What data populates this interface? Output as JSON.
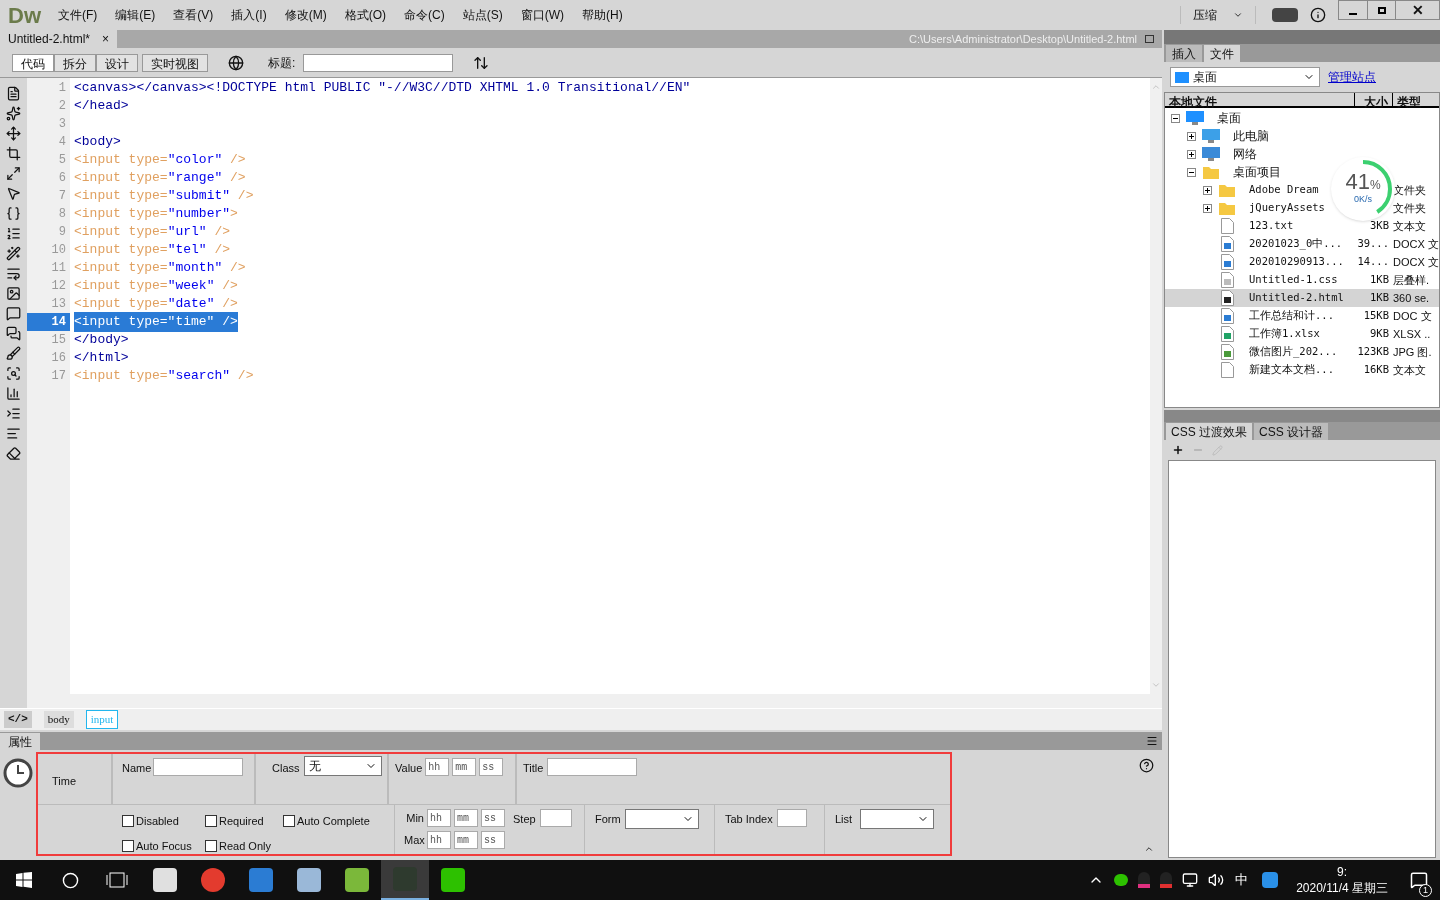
{
  "app": {
    "logo": "Dw",
    "menu": [
      "文件(F)",
      "编辑(E)",
      "查看(V)",
      "插入(I)",
      "修改(M)",
      "格式(O)",
      "命令(C)",
      "站点(S)",
      "窗口(W)",
      "帮助(H)"
    ],
    "compress": "压缩",
    "close": "✕"
  },
  "document": {
    "tab": "Untitled-2.html*",
    "close": "×",
    "path": "C:\\Users\\Administrator\\Desktop\\Untitled-2.html"
  },
  "view_buttons": [
    {
      "label": "代码",
      "selected": true
    },
    {
      "label": "拆分",
      "selected": false
    },
    {
      "label": "设计",
      "selected": false
    },
    {
      "label": "实时视图",
      "selected": false
    }
  ],
  "title_label": "标题:",
  "code": [
    {
      "number": "1",
      "selected": false,
      "segments": [
        {
          "kind": "tag",
          "text": "<canvas></canvas><!DOCTYPE html PUBLIC \"-//W3C//DTD XHTML 1.0 Transitional//EN\""
        }
      ]
    },
    {
      "number": "2",
      "selected": false,
      "segments": [
        {
          "kind": "tag",
          "text": "</head>"
        }
      ]
    },
    {
      "number": "3",
      "selected": false
    },
    {
      "number": "4",
      "selected": false,
      "segments": [
        {
          "kind": "tag",
          "text": "<body>"
        }
      ]
    },
    {
      "number": "5",
      "selected": false,
      "segments": [
        {
          "kind": "faded",
          "text": "<input type="
        },
        {
          "kind": "value",
          "text": "\"color\""
        },
        {
          "kind": "faded",
          "text": " />"
        }
      ]
    },
    {
      "number": "6",
      "selected": false,
      "segments": [
        {
          "kind": "faded",
          "text": "<input type="
        },
        {
          "kind": "value",
          "text": "\"range\""
        },
        {
          "kind": "faded",
          "text": " />"
        }
      ]
    },
    {
      "number": "7",
      "selected": false,
      "segments": [
        {
          "kind": "faded",
          "text": "<input type="
        },
        {
          "kind": "value",
          "text": "\"submit\""
        },
        {
          "kind": "faded",
          "text": " />"
        }
      ]
    },
    {
      "number": "8",
      "selected": false,
      "segments": [
        {
          "kind": "faded",
          "text": "<input type="
        },
        {
          "kind": "value",
          "text": "\"number\""
        },
        {
          "kind": "faded",
          "text": ">"
        }
      ]
    },
    {
      "number": "9",
      "selected": false,
      "segments": [
        {
          "kind": "faded",
          "text": "<input type="
        },
        {
          "kind": "value",
          "text": "\"url\""
        },
        {
          "kind": "faded",
          "text": " />"
        }
      ]
    },
    {
      "number": "10",
      "selected": false,
      "segments": [
        {
          "kind": "faded",
          "text": "<input type="
        },
        {
          "kind": "value",
          "text": "\"tel\""
        },
        {
          "kind": "faded",
          "text": " />"
        }
      ]
    },
    {
      "number": "11",
      "selected": false,
      "segments": [
        {
          "kind": "faded",
          "text": "<input type="
        },
        {
          "kind": "value",
          "text": "\"month\""
        },
        {
          "kind": "faded",
          "text": " />"
        }
      ]
    },
    {
      "number": "12",
      "selected": false,
      "segments": [
        {
          "kind": "faded",
          "text": "<input type="
        },
        {
          "kind": "value",
          "text": "\"week\""
        },
        {
          "kind": "faded",
          "text": " />"
        }
      ]
    },
    {
      "number": "13",
      "selected": false,
      "segments": [
        {
          "kind": "faded",
          "text": "<input type="
        },
        {
          "kind": "value",
          "text": "\"date\""
        },
        {
          "kind": "faded",
          "text": " />"
        }
      ]
    },
    {
      "number": "14",
      "selected": true,
      "segments": [
        {
          "kind": "tag",
          "text": "<input type=\"time\" />"
        }
      ]
    },
    {
      "number": "15",
      "selected": false,
      "segments": [
        {
          "kind": "tag",
          "text": "</body>"
        }
      ]
    },
    {
      "number": "16",
      "selected": false,
      "segments": [
        {
          "kind": "tag",
          "text": "</html>"
        }
      ]
    },
    {
      "number": "17",
      "selected": false,
      "segments": [
        {
          "kind": "faded",
          "text": "<input type="
        },
        {
          "kind": "value",
          "text": "\"search\""
        },
        {
          "kind": "faded",
          "text": " />"
        }
      ]
    }
  ],
  "code_view_toggle": "</>",
  "tag_selector": [
    {
      "label": "body",
      "selected": false
    },
    {
      "label": "input",
      "selected": true
    }
  ],
  "properties": {
    "tab": "属性",
    "element": "Time",
    "name_label": "Name",
    "class_label": "Class",
    "class_value": "无",
    "value_label": "Value",
    "value_fields": [
      {
        "placeholder": "hh"
      },
      {
        "placeholder": "mm"
      },
      {
        "placeholder": "ss"
      }
    ],
    "title_label": "Title",
    "checkboxes": [
      {
        "label": "Disabled",
        "checked": false
      },
      {
        "label": "Required",
        "checked": false
      },
      {
        "label": "Auto Complete",
        "checked": false
      },
      {
        "label": "Auto Focus",
        "checked": false
      },
      {
        "label": "Read Only",
        "checked": false
      }
    ],
    "min_label": "Min",
    "min_fields": [
      {
        "placeholder": "hh"
      },
      {
        "placeholder": "mm"
      },
      {
        "placeholder": "ss"
      }
    ],
    "max_label": "Max",
    "max_fields": [
      {
        "placeholder": "hh"
      },
      {
        "placeholder": "mm"
      },
      {
        "placeholder": "ss"
      }
    ],
    "step_label": "Step",
    "form_label": "Form",
    "tab_index_label": "Tab Index",
    "list_label": "List"
  },
  "files_panel": {
    "tabs": [
      {
        "label": "插入",
        "selected": false
      },
      {
        "label": "文件",
        "selected": true
      }
    ],
    "location": "桌面",
    "manage_link": "管理站点",
    "columns": [
      "本地文件",
      "大小",
      "类型"
    ],
    "tree": [
      {
        "name": "桌面",
        "kind": "desktop",
        "expanded": true,
        "selected": false,
        "children": [
          {
            "name": "此电脑",
            "kind": "computer",
            "expanded": false,
            "selected": false
          },
          {
            "name": "网络",
            "kind": "network",
            "expanded": false,
            "selected": false
          },
          {
            "name": "桌面项目",
            "kind": "folder",
            "expanded": true,
            "selected": false,
            "children": [
              {
                "name": "Adobe Dream",
                "kind": "folder",
                "type": "文件夹",
                "expanded": false,
                "selected": false
              },
              {
                "name": "jQueryAssets",
                "kind": "folder",
                "type": "文件夹",
                "expanded": false,
                "selected": false
              },
              {
                "name": "123.txt",
                "kind": "text",
                "size": "3KB",
                "type": "文本文",
                "selected": false
              },
              {
                "name": "20201023_0中...",
                "kind": "word",
                "size": "39...",
                "type": "DOCX 文",
                "selected": false
              },
              {
                "name": "202010290913...",
                "kind": "word",
                "size": "14...",
                "type": "DOCX 文",
                "selected": false
              },
              {
                "name": "Untitled-1.css",
                "kind": "css",
                "size": "1KB",
                "type": "层叠样.",
                "selected": false
              },
              {
                "name": "Untitled-2.html",
                "kind": "html",
                "size": "1KB",
                "type": "360 se.",
                "selected": true
              },
              {
                "name": "工作总结和计...",
                "kind": "word",
                "size": "15KB",
                "type": "DOC 文",
                "selected": false
              },
              {
                "name": "工作簿1.xlsx",
                "kind": "sheet",
                "size": "9KB",
                "type": "XLSX ..",
                "selected": false
              },
              {
                "name": "微信图片_202...",
                "kind": "image",
                "size": "123KB",
                "type": "JPG 图.",
                "selected": false
              },
              {
                "name": "新建文本文档...",
                "kind": "text",
                "size": "16KB",
                "type": "文本文",
                "selected": false
              }
            ]
          }
        ]
      }
    ]
  },
  "speed_meter": {
    "percent": "41",
    "unit": "%",
    "speed": "0K/s",
    "level": 0.41
  },
  "css_panel": {
    "tabs": [
      {
        "label": "CSS 过渡效果",
        "selected": true
      },
      {
        "label": "CSS 设计器",
        "selected": false
      }
    ]
  },
  "taskbar": {
    "time": "9:",
    "date": "2020/11/4 星期三",
    "ime": "中",
    "notifications": "1"
  }
}
